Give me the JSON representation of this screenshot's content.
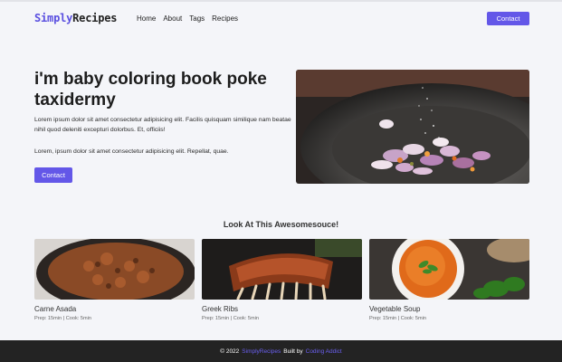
{
  "nav": {
    "logo_part1": "Simply",
    "logo_part2": "Recipes",
    "links": [
      "Home",
      "About",
      "Tags",
      "Recipes"
    ],
    "contact_label": "Contact"
  },
  "hero": {
    "title": "i'm baby coloring book poke taxidermy",
    "paragraph1": "Lorem ipsum dolor sit amet consectetur adipisicing elit. Facilis quisquam similique nam beatae nihil quod deleniti excepturi dolorbus. Et, officiis!",
    "paragraph2": "Lorem, ipsum dolor sit amet consectetur adipisicing elit. Repellat, quae.",
    "button_label": "Contact"
  },
  "featured": {
    "title": "Look At This Awesomesouce!",
    "recipes": [
      {
        "title": "Carne Asada",
        "meta": "Prep: 15min | Cook: 5min"
      },
      {
        "title": "Greek Ribs",
        "meta": "Prep: 15min | Cook: 5min"
      },
      {
        "title": "Vegetable Soup",
        "meta": "Prep: 15min | Cook: 5min"
      }
    ]
  },
  "footer": {
    "prefix": "© 2022",
    "brand": "SimplyRecipes",
    "middle": "Built by",
    "author": "Coding Addict"
  },
  "colors": {
    "accent": "#6357e8",
    "footer_bg": "#232323",
    "page_bg": "#f4f5f9"
  }
}
